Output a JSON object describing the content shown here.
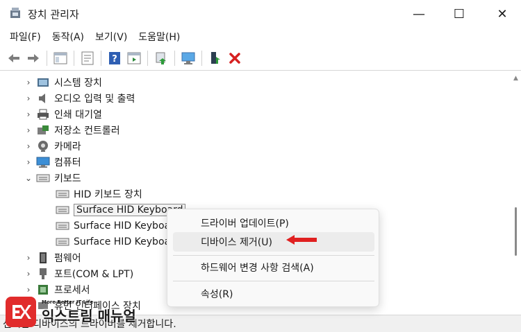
{
  "window": {
    "title": "장치 관리자",
    "minimize_glyph": "—",
    "maximize_glyph": "☐",
    "close_glyph": "✕"
  },
  "menu": [
    "파일(F)",
    "동작(A)",
    "보기(V)",
    "도움말(H)"
  ],
  "toolbar_icons": [
    "back-arrow-icon",
    "forward-arrow-icon",
    "show-hide-console-tree-icon",
    "properties-icon",
    "help-icon",
    "action-pane-icon",
    "update-driver-icon",
    "scan-hardware-icon",
    "enable-device-icon",
    "uninstall-device-icon"
  ],
  "tree": {
    "categories": [
      {
        "label": "시스템 장치",
        "icon": "system-device-icon",
        "expanded": false
      },
      {
        "label": "오디오 입력 및 출력",
        "icon": "speaker-icon",
        "expanded": false
      },
      {
        "label": "인쇄 대기열",
        "icon": "printer-icon",
        "expanded": false
      },
      {
        "label": "저장소 컨트롤러",
        "icon": "storage-controller-icon",
        "expanded": false
      },
      {
        "label": "카메라",
        "icon": "camera-icon",
        "expanded": false
      },
      {
        "label": "컴퓨터",
        "icon": "computer-icon",
        "expanded": false
      },
      {
        "label": "키보드",
        "icon": "keyboard-icon",
        "expanded": true
      }
    ],
    "keyboard_children": [
      {
        "label": "HID 키보드 장치",
        "selected": false
      },
      {
        "label": "Surface HID Keyboard",
        "selected": true
      },
      {
        "label": "Surface HID Keyboar",
        "selected": false
      },
      {
        "label": "Surface HID Keyboar",
        "selected": false
      }
    ],
    "categories_after": [
      {
        "label": "펌웨어",
        "icon": "firmware-icon",
        "expanded": false
      },
      {
        "label": "포트(COM & LPT)",
        "icon": "port-icon",
        "expanded": false
      },
      {
        "label": "프로세서",
        "icon": "processor-icon",
        "expanded": false
      },
      {
        "label": "휴먼 인터페이스 장치",
        "icon": "hid-icon",
        "expanded": false
      }
    ]
  },
  "context_menu": {
    "items": [
      {
        "label": "드라이버 업데이트(P)",
        "highlighted": false
      },
      {
        "label": "디바이스 제거(U)",
        "highlighted": true
      },
      {
        "label": "하드웨어 변경 사항 검색(A)",
        "highlighted": false
      },
      {
        "label": "속성(R)",
        "highlighted": false
      }
    ]
  },
  "status": {
    "text": "선택한 디바이스의 드라이버를 제거합니다."
  },
  "watermark": {
    "logo": "EX",
    "tagline": "More Better IT Life",
    "brand": "익스트림 매뉴얼"
  },
  "colors": {
    "accent_red": "#e12c2c",
    "arrow_red": "#e02020",
    "selection_border": "#8a8a8a",
    "menu_hover": "#ececec"
  }
}
